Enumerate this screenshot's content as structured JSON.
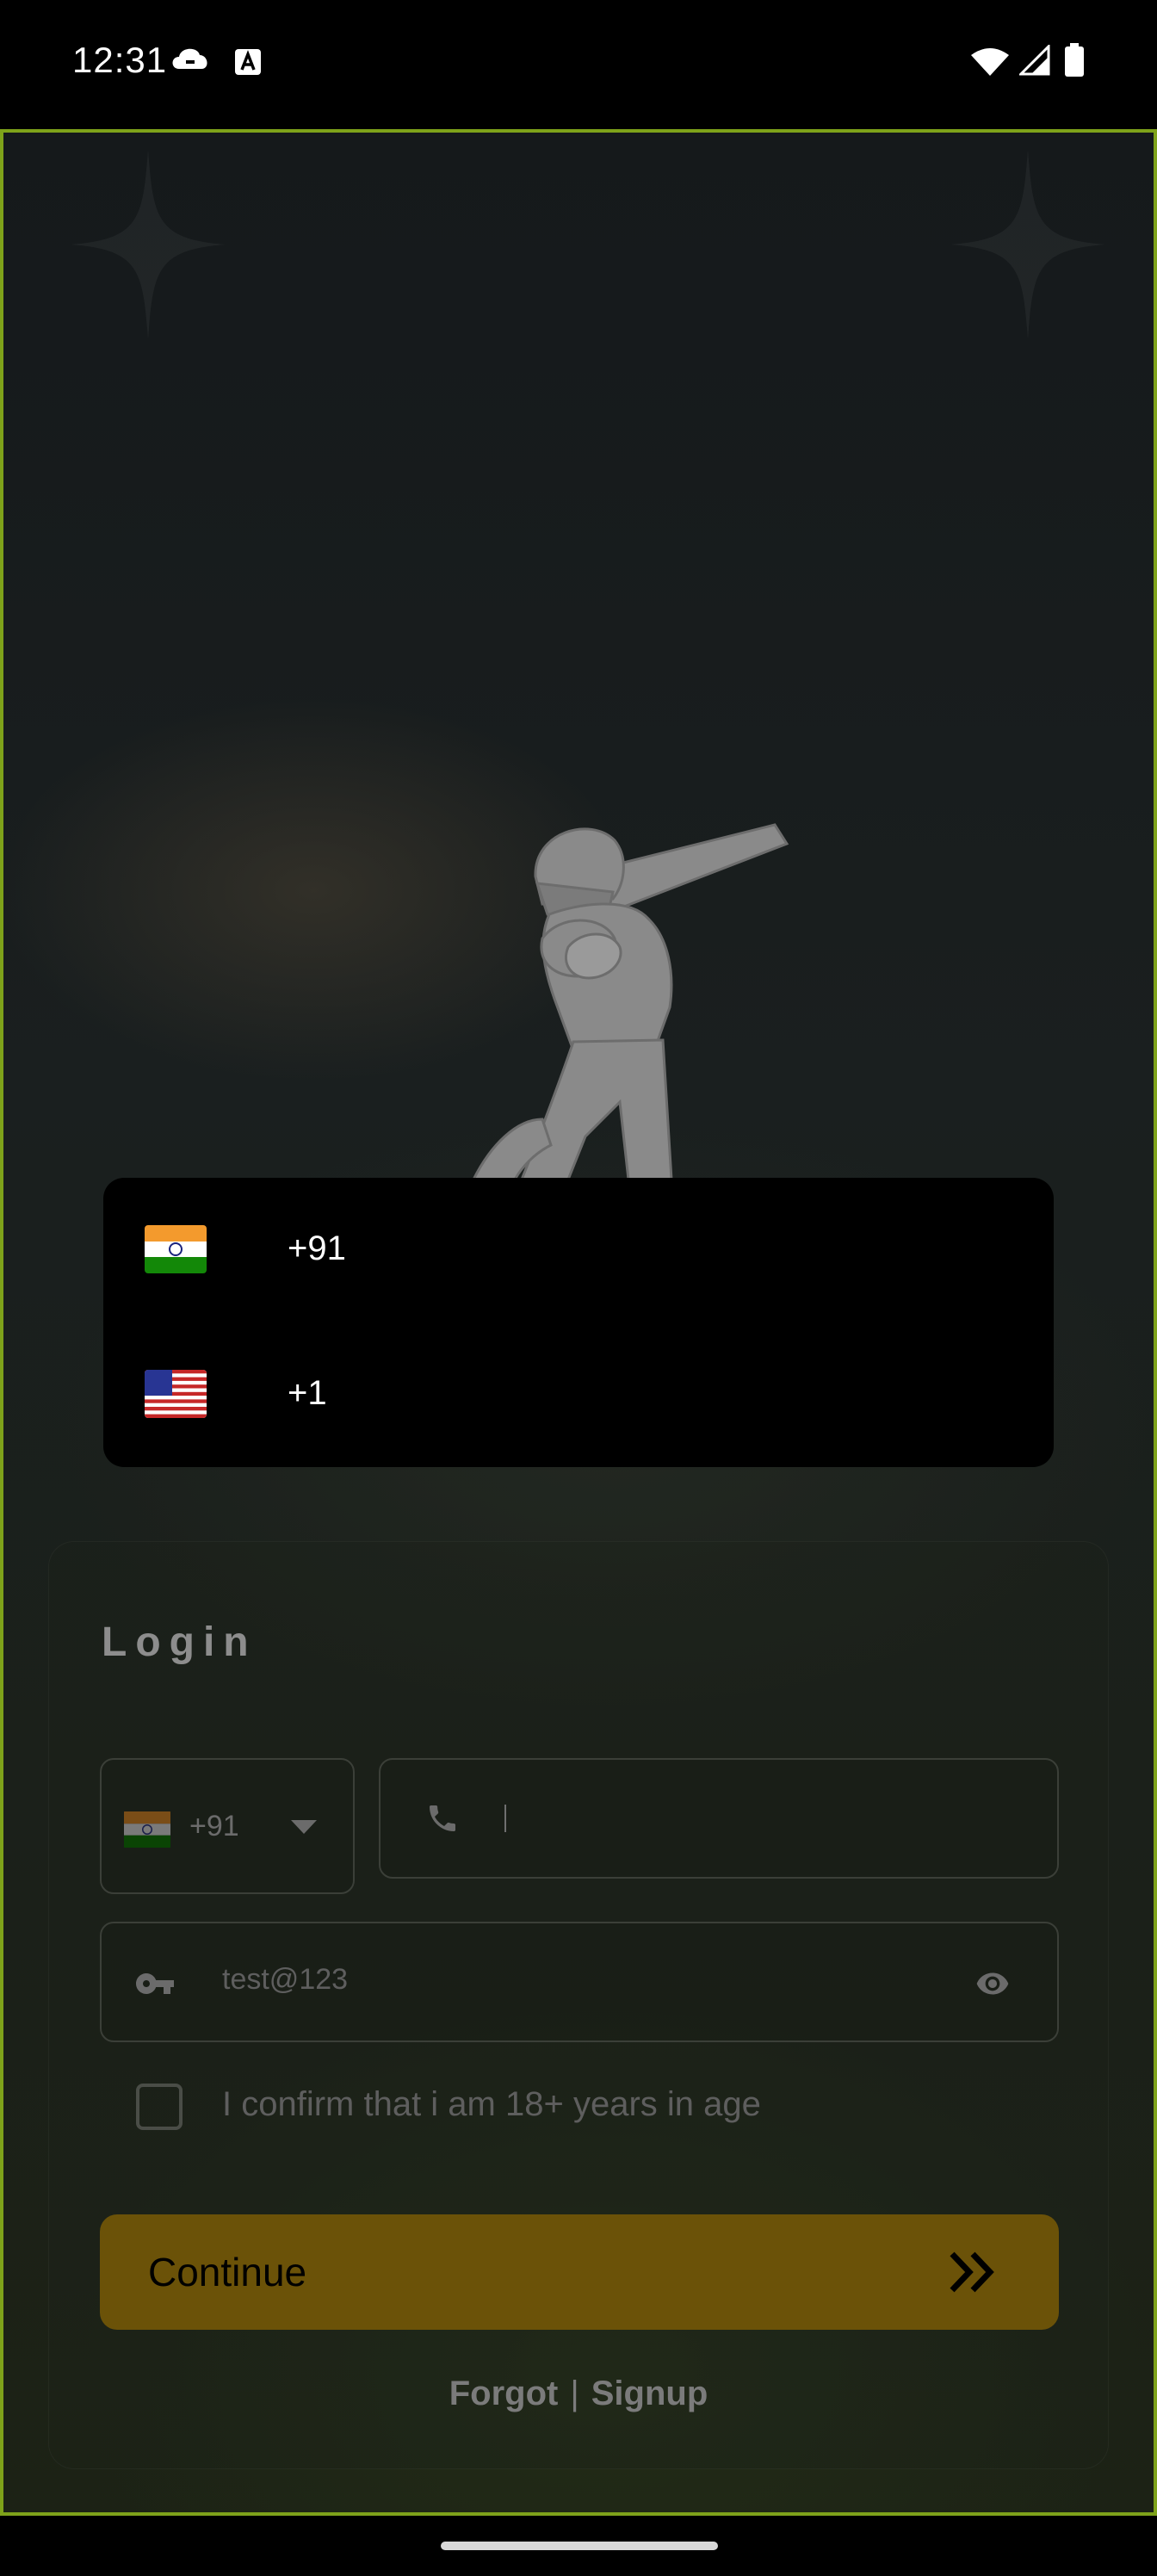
{
  "status_bar": {
    "time": "12:31",
    "icons": [
      "cloud-icon",
      "a-notification-icon",
      "wifi-icon",
      "signal-icon",
      "battery-icon"
    ]
  },
  "country_menu": {
    "options": [
      {
        "flag": "india-flag-icon",
        "code": "+91"
      },
      {
        "flag": "usa-flag-icon",
        "code": "+1"
      }
    ]
  },
  "login": {
    "title": "Login",
    "country_select": {
      "flag": "india-flag-icon",
      "code": "+91"
    },
    "phone": {
      "value": "",
      "placeholder": ""
    },
    "password": {
      "value": "test@123"
    },
    "age_confirm_label": "I confirm that i am 18+ years in age",
    "continue_label": "Continue",
    "forgot_label": "Forgot",
    "separator": "|",
    "signup_label": "Signup"
  },
  "colors": {
    "frame_border": "#7ea21a",
    "continue_button": "#6b5208",
    "menu_background": "#000000"
  }
}
